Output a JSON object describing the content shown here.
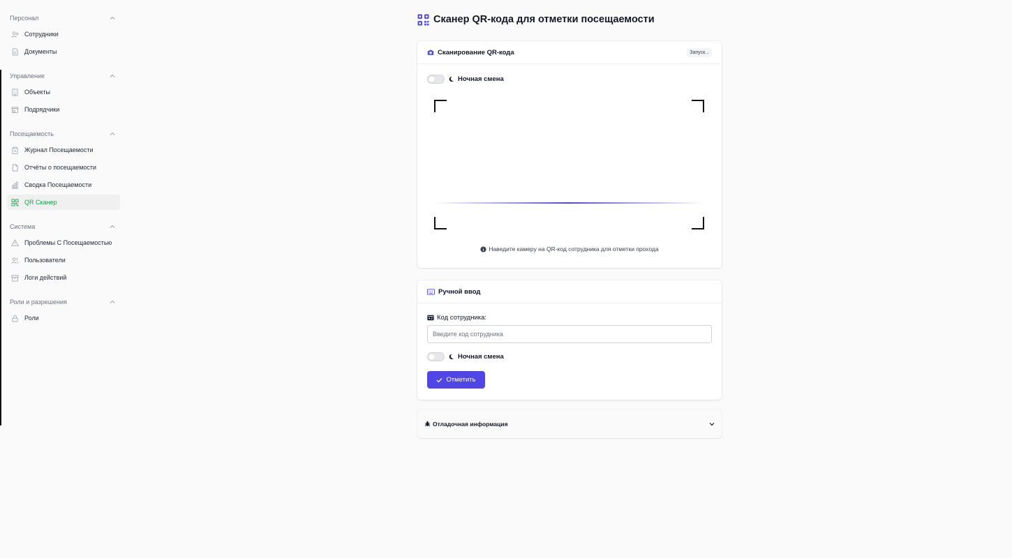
{
  "sidebar": {
    "groups": [
      {
        "title": "Персонал",
        "items": [
          {
            "label": "Сотрудники",
            "icon": "users-cog-icon"
          },
          {
            "label": "Документы",
            "icon": "document-icon"
          }
        ]
      },
      {
        "title": "Управление",
        "items": [
          {
            "label": "Объекты",
            "icon": "building-icon"
          },
          {
            "label": "Подрядчики",
            "icon": "store-icon"
          }
        ]
      },
      {
        "title": "Посещаемость",
        "items": [
          {
            "label": "Журнал Посещаемости",
            "icon": "clipboard-icon"
          },
          {
            "label": "Отчёты о посещаемости",
            "icon": "file-icon"
          },
          {
            "label": "Сводка Посещаемости",
            "icon": "bar-chart-icon"
          },
          {
            "label": "QR Сканер",
            "icon": "qr-icon",
            "active": true
          }
        ]
      },
      {
        "title": "Система",
        "items": [
          {
            "label": "Проблемы С Посещаемостью",
            "icon": "warning-icon"
          },
          {
            "label": "Пользователи",
            "icon": "users-icon"
          },
          {
            "label": "Логи действий",
            "icon": "logs-icon"
          }
        ]
      },
      {
        "title": "Роли и разрешения",
        "items": [
          {
            "label": "Роли",
            "icon": "lock-icon"
          }
        ]
      }
    ]
  },
  "page": {
    "title": "Сканер QR-кода для отметки посещаемости"
  },
  "scan_card": {
    "title": "Сканирование QR-кода",
    "status": "Запуск...",
    "night_shift_label": "Ночная смена",
    "hint": "Наведите камеру на QR-код сотрудника для отметки прохода"
  },
  "manual_card": {
    "title": "Ручной ввод",
    "code_label": "Код сотрудника:",
    "code_value": "",
    "code_placeholder": "Введите код сотрудника",
    "night_shift_label": "Ночная смена",
    "submit_label": "Отметить"
  },
  "debug": {
    "title": "Отладочная информация"
  },
  "colors": {
    "accent": "#4f46e5",
    "active_nav": "#16a34a"
  }
}
